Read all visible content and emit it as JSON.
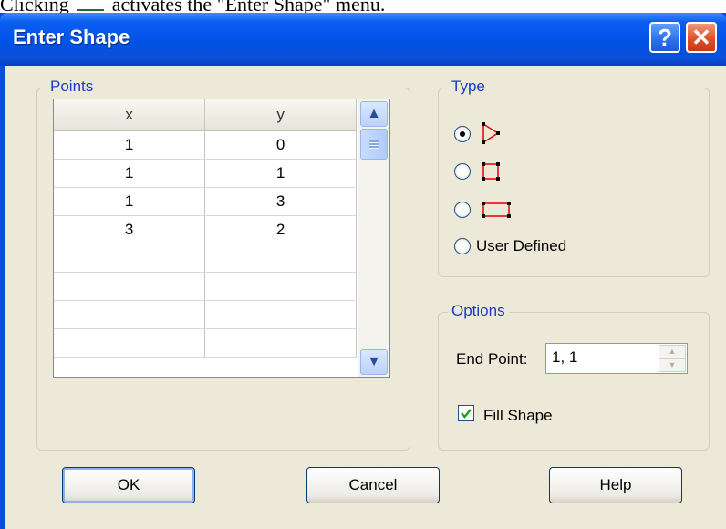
{
  "document_line": {
    "before": "Clicking",
    "after": "activates the \"Enter Shape\" menu."
  },
  "dialog": {
    "title": "Enter Shape",
    "title_buttons": {
      "help": "?",
      "close": "✕"
    }
  },
  "points": {
    "legend": "Points",
    "columns": [
      "x",
      "y"
    ],
    "rows": [
      {
        "x": "1",
        "y": "0"
      },
      {
        "x": "1",
        "y": "1"
      },
      {
        "x": "1",
        "y": "3"
      },
      {
        "x": "3",
        "y": "2"
      },
      {
        "x": "",
        "y": ""
      },
      {
        "x": "",
        "y": ""
      },
      {
        "x": "",
        "y": ""
      },
      {
        "x": "",
        "y": ""
      }
    ]
  },
  "type": {
    "legend": "Type",
    "options": [
      {
        "icon": "triangle-shape-icon",
        "selected": true
      },
      {
        "icon": "square-shape-icon",
        "selected": false
      },
      {
        "icon": "rectangle-shape-icon",
        "selected": false
      },
      {
        "label": "User Defined",
        "selected": false
      }
    ]
  },
  "options": {
    "legend": "Options",
    "end_point_label": "End Point:",
    "end_point_value": "1, 1",
    "fill_shape_label": "Fill Shape",
    "fill_shape_checked": true
  },
  "buttons": {
    "ok": "OK",
    "cancel": "Cancel",
    "help": "Help"
  }
}
